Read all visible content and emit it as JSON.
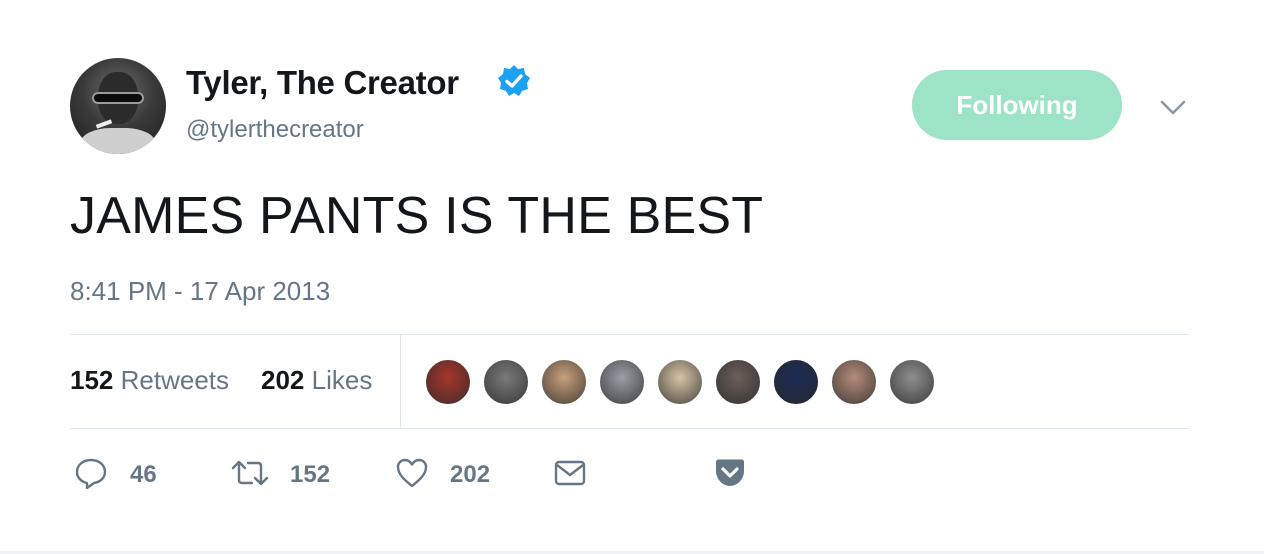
{
  "tweet": {
    "display_name": "Tyler, The Creator",
    "handle": "@tylerthecreator",
    "verified_icon": "verified-badge",
    "follow_button_label": "Following",
    "follow_button_color": "#9de3c6",
    "caret_icon": "chevron-down-icon",
    "text": "JAMES PANTS IS THE BEST",
    "timestamp": "8:41 PM - 17 Apr 2013"
  },
  "stats": {
    "retweets_count": "152",
    "retweets_label": "Retweets",
    "likes_count": "202",
    "likes_label": "Likes"
  },
  "likers": [
    {
      "color": "#a8352a"
    },
    {
      "color": "#7a7a7a"
    },
    {
      "color": "#c9a07a"
    },
    {
      "color": "#9aa0a8"
    },
    {
      "color": "#d7c4a6"
    },
    {
      "color": "#6b5e58"
    },
    {
      "color": "#1b2a55"
    },
    {
      "color": "#b58c7a"
    },
    {
      "color": "#8f8f8f"
    }
  ],
  "actions": {
    "reply_count": "46",
    "retweet_count": "152",
    "like_count": "202"
  },
  "colors": {
    "verified_blue": "#1da1f2",
    "secondary_text": "#657786",
    "pocket_gray": "#657786"
  }
}
